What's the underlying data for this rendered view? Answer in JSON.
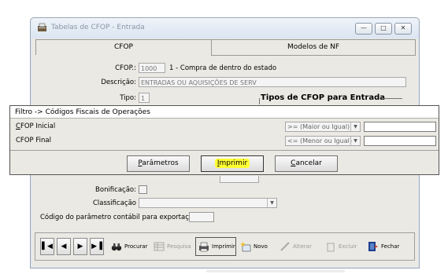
{
  "window": {
    "title": "Tabelas de CFOP - Entrada",
    "min": "—",
    "max": "□",
    "close": "✕"
  },
  "tabs": [
    {
      "label": "CFOP"
    },
    {
      "label": "Modelos de NF"
    }
  ],
  "form": {
    "cfop_label": "CFOP.:",
    "cfop_value": "1000",
    "cfop_desc": "1 - Compra de dentro do estado",
    "descricao_label": "Descrição:",
    "descricao_value": "ENTRADAS OU AQUISIÇÕES DE SERV",
    "tipo_label": "Tipo:",
    "tipo_value": "1",
    "tipos_group": "Tipos de CFOP para Entrada",
    "bonificacao_label": "Bonificação:",
    "classificacao_label": "Classificação",
    "codigo_label": "Código do parâmetro contábil para exportação"
  },
  "dialog": {
    "title": "Filtro -> Códigos Fiscais de Operações",
    "cfop_inicial_rest": "FOP Inicial",
    "cfop_inicial_first": "C",
    "cfop_final": "CFOP Final",
    "op_inicial": ">= (Maior ou Igual)",
    "op_final": "<= (Menor ou Igual)",
    "btn_parametros_first": "P",
    "btn_parametros_rest": "arâmetros",
    "btn_imprimir_first": "I",
    "btn_imprimir_rest": "mprimir",
    "btn_cancelar_first": "C",
    "btn_cancelar_rest": "ancelar"
  },
  "toolbar": {
    "procurar": "Procurar",
    "pesquisa": "Pesquisa",
    "imprimir": "Imprimir",
    "novo": "Novo",
    "alterar": "Alterar",
    "excluir": "Excluir",
    "fechar": "Fechar"
  },
  "colors": {
    "highlight": "#ffff33",
    "window_bg": "#ebe9e3"
  }
}
